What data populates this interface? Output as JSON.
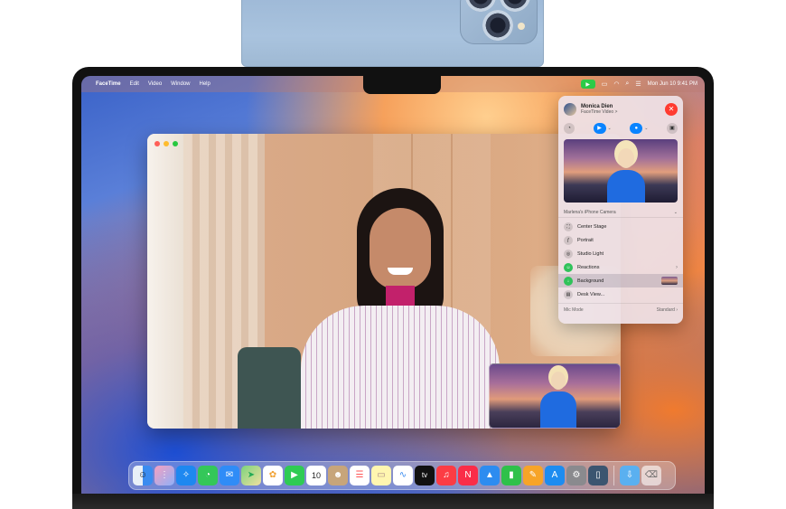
{
  "menubar": {
    "app_name": "FaceTime",
    "items": [
      "Edit",
      "Video",
      "Window",
      "Help"
    ],
    "clock": "Mon Jun 10  9:41 PM"
  },
  "call_panel": {
    "contact_name": "Monica Dien",
    "call_type": "FaceTime Video >",
    "camera_source": "Marlena's iPhone Camera",
    "options": [
      {
        "label": "Center Stage",
        "icon": "center-stage-icon"
      },
      {
        "label": "Portrait",
        "icon": "portrait-icon"
      },
      {
        "label": "Studio Light",
        "icon": "studio-light-icon"
      },
      {
        "label": "Reactions",
        "icon": "reactions-icon"
      },
      {
        "label": "Background",
        "icon": "background-icon"
      },
      {
        "label": "Desk View...",
        "icon": "desk-view-icon"
      }
    ],
    "mic_mode_label": "Mic Mode",
    "mic_mode_value": "Standard"
  },
  "dock": {
    "apps": [
      "Finder",
      "Launchpad",
      "Safari",
      "Messages",
      "Mail",
      "Maps",
      "Photos",
      "FaceTime",
      "Calendar",
      "Contacts",
      "Reminders",
      "Notes",
      "Freeform",
      "TV",
      "Music",
      "News",
      "Keynote",
      "Numbers",
      "Pages",
      "App Store",
      "System Settings",
      "iPhone Mirroring",
      "Downloads",
      "Trash"
    ],
    "calendar_day": "10",
    "tv_label": "tv"
  },
  "colors": {
    "accent": "#0a84ff",
    "end_call": "#ff3b30",
    "active_green": "#30c25a"
  }
}
